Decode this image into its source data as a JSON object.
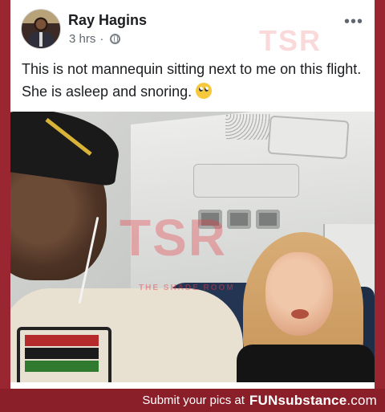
{
  "post": {
    "author": "Ray Hagins",
    "time": "3 hrs",
    "dot": "·",
    "more": "•••",
    "text": "This is not mannequin sitting next to me on this flight. She is asleep and snoring.",
    "emoji": "face-with-rolling-eyes"
  },
  "watermarks": {
    "top": "TSR",
    "middle": "TSR",
    "small": "THE SHADE ROOM"
  },
  "footer": {
    "submit_text": "Submit your pics at",
    "brand_fun": "FUN",
    "brand_sub": "substance",
    "brand_com": ".com"
  },
  "colors": {
    "background": "#8a1f29",
    "card": "#ffffff",
    "text": "#1c1e21",
    "meta": "#606770"
  }
}
